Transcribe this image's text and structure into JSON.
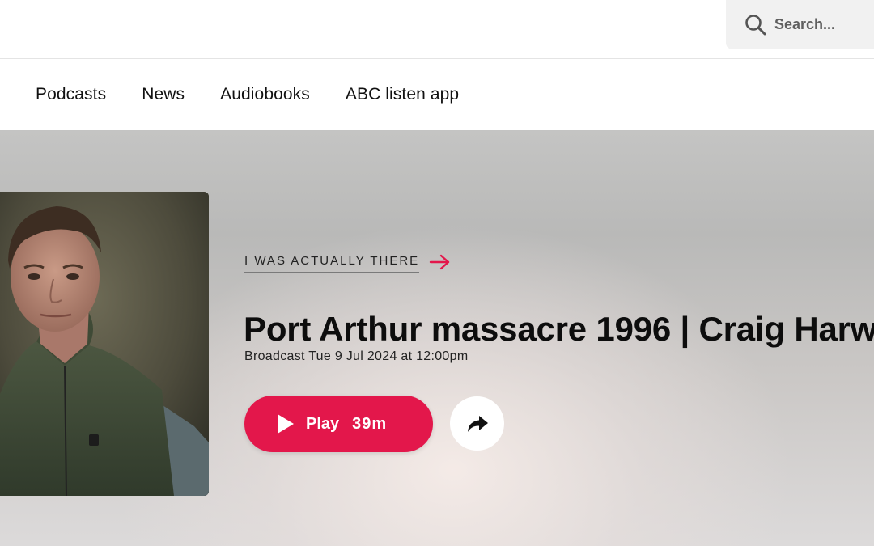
{
  "search": {
    "placeholder": "Search..."
  },
  "nav": {
    "items": [
      {
        "label": "Podcasts"
      },
      {
        "label": "News"
      },
      {
        "label": "Audiobooks"
      },
      {
        "label": "ABC listen app"
      }
    ]
  },
  "episode": {
    "program": "I WAS ACTUALLY THERE",
    "title": "Port Arthur massacre 1996 | Craig Harw",
    "broadcast": "Broadcast Tue 9 Jul 2024 at 12:00pm",
    "play_label": "Play",
    "duration": "39m"
  },
  "icons": {
    "search": "search-icon",
    "program_link": "arrow-right-icon",
    "play": "play-icon",
    "share": "share-icon"
  },
  "colors": {
    "accent": "#e3174b",
    "text": "#111111",
    "search_bg": "#f1f1f1"
  }
}
